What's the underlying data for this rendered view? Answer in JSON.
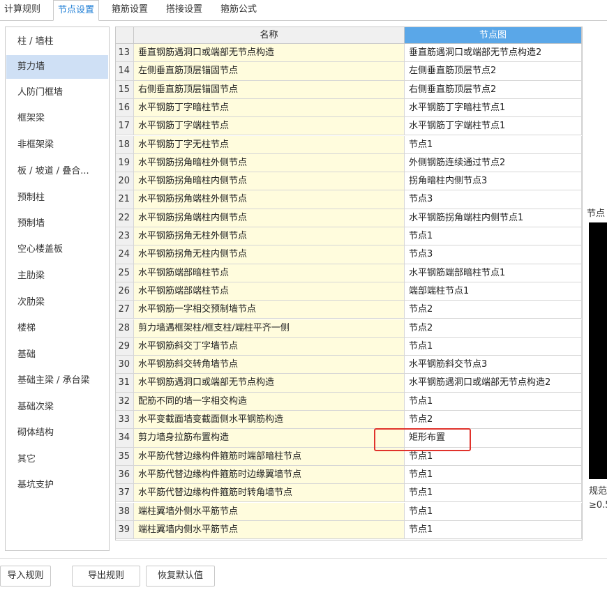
{
  "tabs": [
    {
      "label": "计算规则"
    },
    {
      "label": "节点设置"
    },
    {
      "label": "箍筋设置"
    },
    {
      "label": "搭接设置"
    },
    {
      "label": "箍筋公式"
    }
  ],
  "sidebar": {
    "items": [
      {
        "label": "柱 / 墙柱"
      },
      {
        "label": "剪力墙"
      },
      {
        "label": "人防门框墙"
      },
      {
        "label": "框架梁"
      },
      {
        "label": "非框架梁"
      },
      {
        "label": "板 / 坡道 / 叠合..."
      },
      {
        "label": "预制柱"
      },
      {
        "label": "预制墙"
      },
      {
        "label": "空心楼盖板"
      },
      {
        "label": "主肋梁"
      },
      {
        "label": "次肋梁"
      },
      {
        "label": "楼梯"
      },
      {
        "label": "基础"
      },
      {
        "label": "基础主梁 / 承台梁"
      },
      {
        "label": "基础次梁"
      },
      {
        "label": "砌体结构"
      },
      {
        "label": "其它"
      },
      {
        "label": "基坑支护"
      }
    ]
  },
  "table": {
    "headers": {
      "name": "名称",
      "node": "节点图"
    },
    "rows": [
      {
        "num": "13",
        "name": "垂直钢筋遇洞口或端部无节点构造",
        "node": "垂直筋遇洞口或端部无节点构造2"
      },
      {
        "num": "14",
        "name": "左侧垂直筋顶层锚固节点",
        "node": "左侧垂直筋顶层节点2"
      },
      {
        "num": "15",
        "name": "右侧垂直筋顶层锚固节点",
        "node": "右侧垂直筋顶层节点2"
      },
      {
        "num": "16",
        "name": "水平钢筋丁字暗柱节点",
        "node": "水平钢筋丁字暗柱节点1"
      },
      {
        "num": "17",
        "name": "水平钢筋丁字端柱节点",
        "node": "水平钢筋丁字端柱节点1"
      },
      {
        "num": "18",
        "name": "水平钢筋丁字无柱节点",
        "node": "节点1"
      },
      {
        "num": "19",
        "name": "水平钢筋拐角暗柱外侧节点",
        "node": "外侧钢筋连续通过节点2"
      },
      {
        "num": "20",
        "name": "水平钢筋拐角暗柱内侧节点",
        "node": "拐角暗柱内侧节点3"
      },
      {
        "num": "21",
        "name": "水平钢筋拐角端柱外侧节点",
        "node": "节点3"
      },
      {
        "num": "22",
        "name": "水平钢筋拐角端柱内侧节点",
        "node": "水平钢筋拐角端柱内侧节点1"
      },
      {
        "num": "23",
        "name": "水平钢筋拐角无柱外侧节点",
        "node": "节点1"
      },
      {
        "num": "24",
        "name": "水平钢筋拐角无柱内侧节点",
        "node": "节点3"
      },
      {
        "num": "25",
        "name": "水平钢筋端部暗柱节点",
        "node": "水平钢筋端部暗柱节点1"
      },
      {
        "num": "26",
        "name": "水平钢筋端部端柱节点",
        "node": "端部端柱节点1"
      },
      {
        "num": "27",
        "name": "水平钢筋一字相交预制墙节点",
        "node": "节点2"
      },
      {
        "num": "28",
        "name": "剪力墙遇框架柱/框支柱/端柱平齐一侧",
        "node": "节点2"
      },
      {
        "num": "29",
        "name": "水平钢筋斜交丁字墙节点",
        "node": "节点1"
      },
      {
        "num": "30",
        "name": "水平钢筋斜交转角墙节点",
        "node": "水平钢筋斜交节点3"
      },
      {
        "num": "31",
        "name": "水平钢筋遇洞口或端部无节点构造",
        "node": "水平钢筋遇洞口或端部无节点构造2"
      },
      {
        "num": "32",
        "name": "配筋不同的墙一字相交构造",
        "node": "节点1"
      },
      {
        "num": "33",
        "name": "水平变截面墙变截面侧水平钢筋构造",
        "node": "节点2"
      },
      {
        "num": "34",
        "name": "剪力墙身拉筋布置构造",
        "node": "矩形布置"
      },
      {
        "num": "35",
        "name": "水平筋代替边缘构件箍筋时端部暗柱节点",
        "node": "节点1"
      },
      {
        "num": "36",
        "name": "水平筋代替边缘构件箍筋时边缘翼墙节点",
        "node": "节点1"
      },
      {
        "num": "37",
        "name": "水平筋代替边缘构件箍筋时转角墙节点",
        "node": "节点1"
      },
      {
        "num": "38",
        "name": "端柱翼墙外侧水平筋节点",
        "node": "节点1"
      },
      {
        "num": "39",
        "name": "端柱翼墙内侧水平筋节点",
        "node": "节点1"
      }
    ]
  },
  "preview": {
    "title": "节点",
    "note1": "规范",
    "note2": "≥0.5"
  },
  "buttons": {
    "import": "导入规则",
    "export": "导出规则",
    "restore": "恢复默认值"
  },
  "colors": {
    "accent": "#1f7fd6",
    "header_selected": "#5aa7e8",
    "name_cell_bg": "#fffcdd",
    "sidebar_selected": "#cfe0f5",
    "highlight_border": "#e0322b"
  }
}
